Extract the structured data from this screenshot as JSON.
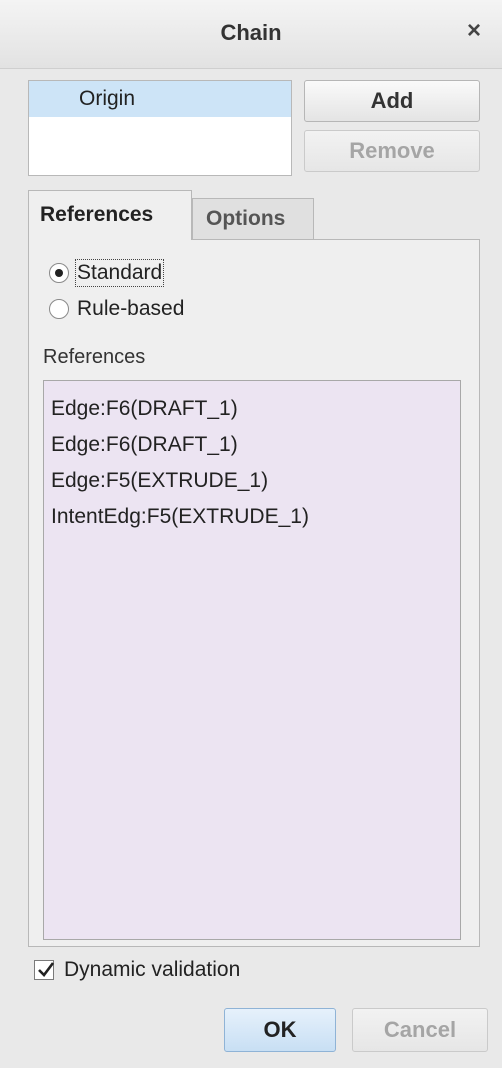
{
  "window": {
    "title": "Chain",
    "close_glyph": "×"
  },
  "chain_list": {
    "items": [
      "Origin"
    ]
  },
  "buttons": {
    "add": "Add",
    "remove": "Remove",
    "ok": "OK",
    "cancel": "Cancel"
  },
  "tabs": [
    {
      "label": "References",
      "active": true
    },
    {
      "label": "Options",
      "active": false
    }
  ],
  "references_tab": {
    "mode_options": [
      {
        "label": "Standard",
        "selected": true
      },
      {
        "label": "Rule-based",
        "selected": false
      }
    ],
    "list_heading": "References",
    "references": [
      "Edge:F6(DRAFT_1)",
      "Edge:F6(DRAFT_1)",
      "Edge:F5(EXTRUDE_1)",
      "IntentEdg:F5(EXTRUDE_1)"
    ]
  },
  "dynamic_validation": {
    "label": "Dynamic validation",
    "checked": true
  },
  "colors": {
    "accent": "#cde4f7",
    "list_bg": "#ece4f2"
  }
}
